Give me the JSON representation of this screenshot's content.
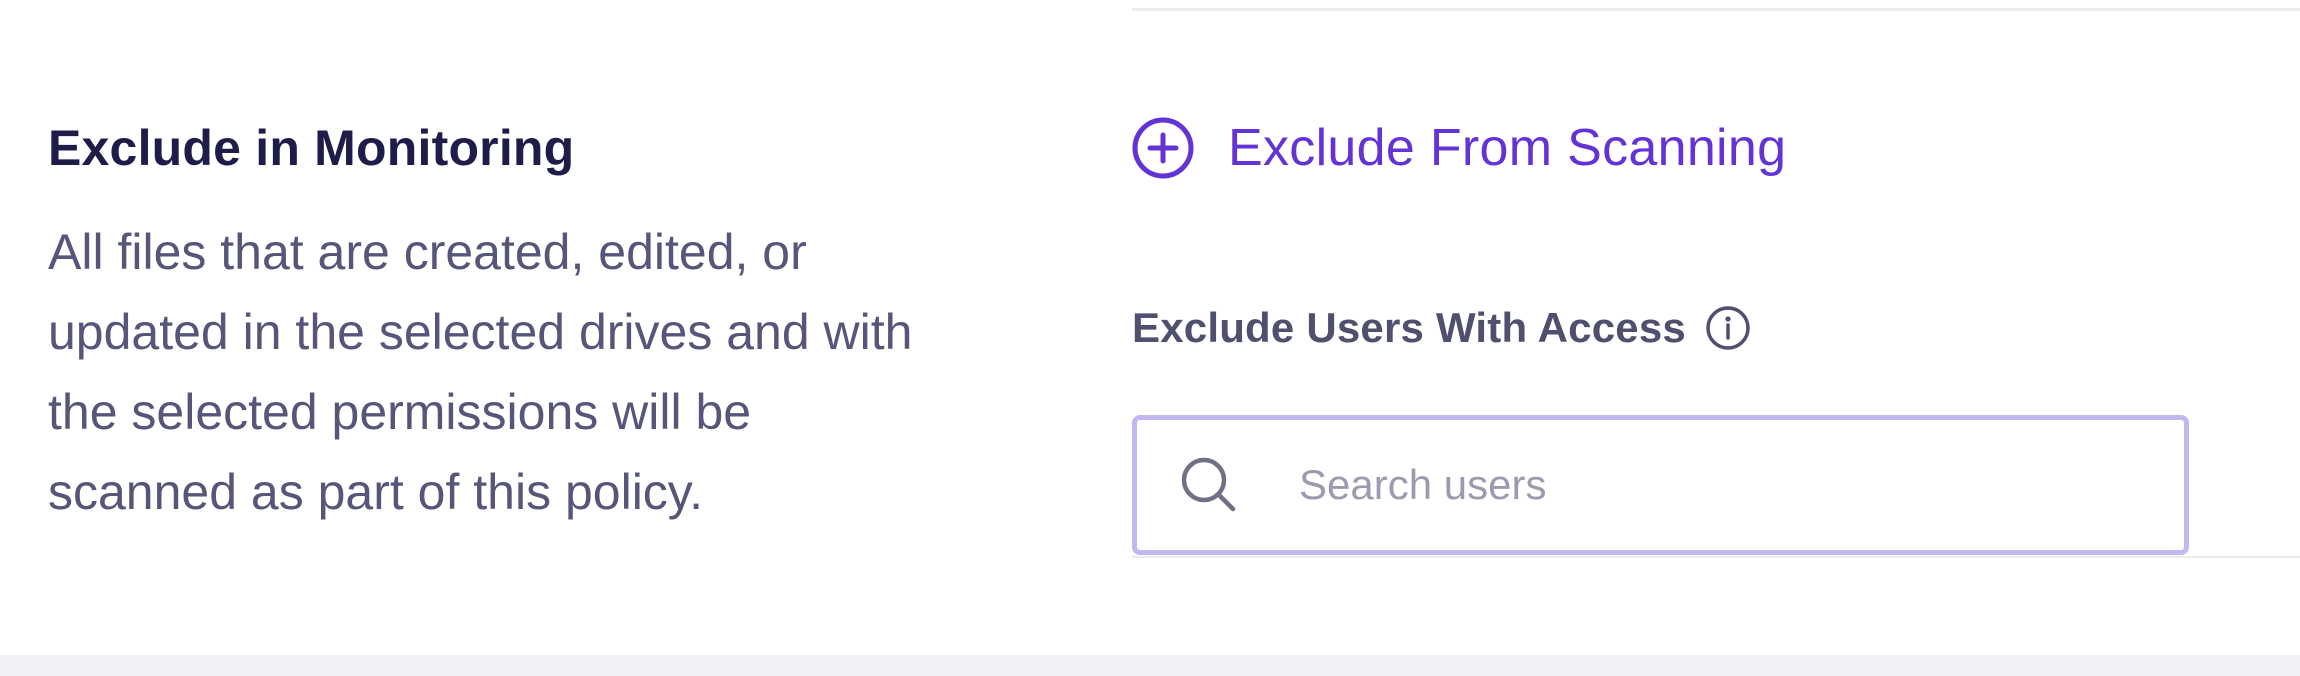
{
  "section": {
    "title": "Exclude in Monitoring",
    "description": "All files that are created, edited, or updated in the selected drives and with the selected permissions will be scanned as part of this policy."
  },
  "exclude_button": {
    "label": "Exclude From Scanning",
    "icon": "plus-circle-icon"
  },
  "exclude_users": {
    "label": "Exclude Users With Access",
    "info_icon": "info-icon",
    "search_placeholder": "Search users",
    "search_value": ""
  },
  "colors": {
    "accent": "#6333d6",
    "title": "#1e1c48",
    "body_text": "#56567a",
    "input_border": "#c4b6ef",
    "placeholder": "#9b9bb0"
  }
}
